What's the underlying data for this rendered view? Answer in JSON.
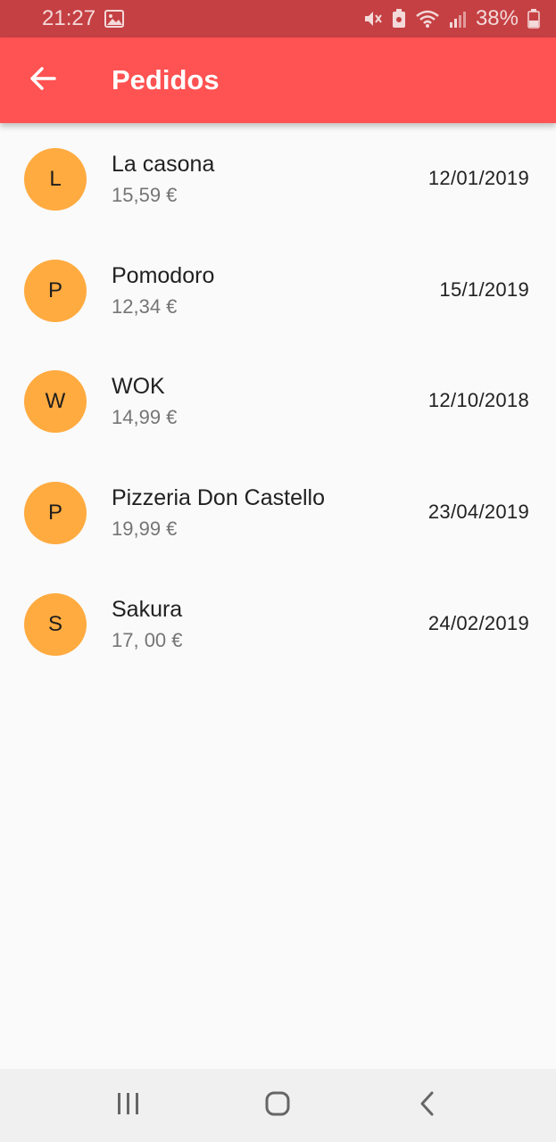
{
  "status_bar": {
    "time": "21:27",
    "battery": "38%",
    "icons": [
      "image-icon",
      "mute-icon",
      "battery-saver-icon",
      "wifi-icon",
      "signal-icon",
      "battery-icon"
    ]
  },
  "app_bar": {
    "title": "Pedidos",
    "back_icon": "arrow-left-icon"
  },
  "orders": [
    {
      "initial": "L",
      "name": "La casona",
      "price": "15,59 €",
      "date": "12/01/2019"
    },
    {
      "initial": "P",
      "name": "Pomodoro",
      "price": "12,34 €",
      "date": "15/1/2019"
    },
    {
      "initial": "W",
      "name": "WOK",
      "price": "14,99 €",
      "date": "12/10/2018"
    },
    {
      "initial": "P",
      "name": "Pizzeria Don Castello",
      "price": "19,99 €",
      "date": "23/04/2019"
    },
    {
      "initial": "S",
      "name": "Sakura",
      "price": "17, 00 €",
      "date": "24/02/2019"
    }
  ],
  "nav_bar": {
    "buttons": [
      "recents-icon",
      "home-icon",
      "back-icon"
    ]
  },
  "colors": {
    "status_bar": "#c54043",
    "app_bar": "#ff5252",
    "avatar": "#ffab40",
    "background": "#fafafa",
    "nav_bar": "#f0f0f0"
  }
}
